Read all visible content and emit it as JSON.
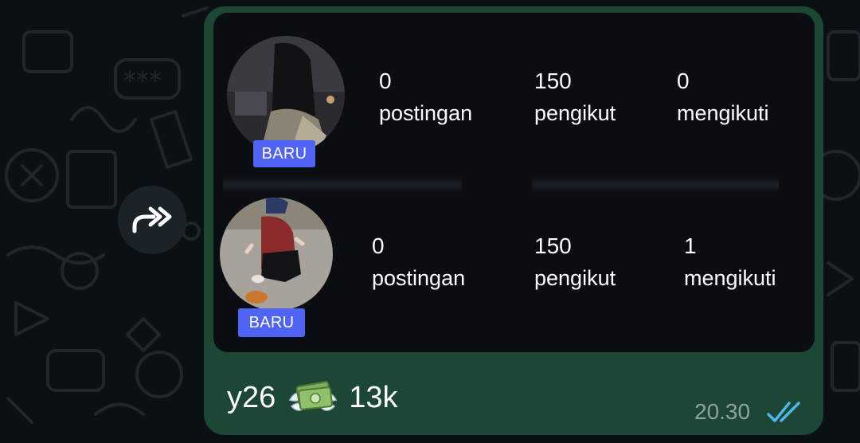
{
  "message": {
    "caption_text": "y26",
    "caption_emoji": "money-with-wings-emoji",
    "caption_suffix": "13k",
    "time": "20.30",
    "status_icon": "double-check-read-icon",
    "read_color": "#4fb6ec"
  },
  "forward_icon": "forward-arrows-icon",
  "accounts": [
    {
      "badge": "BARU",
      "stats": [
        {
          "value": "0",
          "label": "postingan"
        },
        {
          "value": "150",
          "label": "pengikut"
        },
        {
          "value": "0",
          "label": "mengikuti"
        }
      ]
    },
    {
      "badge": "BARU",
      "stats": [
        {
          "value": "0",
          "label": "postingan"
        },
        {
          "value": "150",
          "label": "pengikut"
        },
        {
          "value": "1",
          "label": "mengikuti"
        }
      ]
    }
  ],
  "colors": {
    "bubble": "#1c4734",
    "badge": "#4f63f5",
    "background": "#0b1014"
  }
}
